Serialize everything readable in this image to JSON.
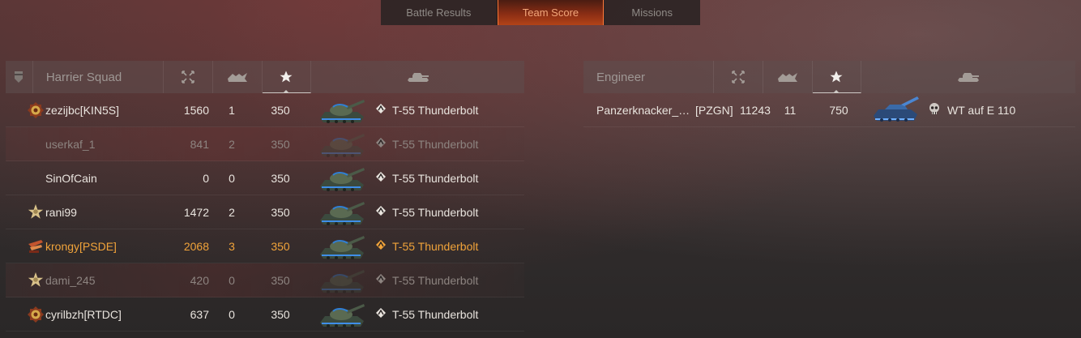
{
  "tabs": [
    "Battle Results",
    "Team Score",
    "Missions"
  ],
  "left": {
    "team_name": "Harrier Squad",
    "players": [
      {
        "name": "zezijbc[KIN5S]",
        "damage": "1560",
        "kills": "1",
        "xp": "350",
        "vehicle": "T-55 Thunderbolt",
        "badge": "medal-icon",
        "state": "normal"
      },
      {
        "name": "userkaf_1",
        "damage": "841",
        "kills": "2",
        "xp": "350",
        "vehicle": "T-55 Thunderbolt",
        "badge": "",
        "state": "dim"
      },
      {
        "name": "SinOfCain",
        "damage": "0",
        "kills": "0",
        "xp": "350",
        "vehicle": "T-55 Thunderbolt",
        "badge": "",
        "state": "normal"
      },
      {
        "name": "rani99",
        "damage": "1472",
        "kills": "2",
        "xp": "350",
        "vehicle": "T-55 Thunderbolt",
        "badge": "star-medal-icon",
        "state": "normal"
      },
      {
        "name": "krongy[PSDE]",
        "damage": "2068",
        "kills": "3",
        "xp": "350",
        "vehicle": "T-55 Thunderbolt",
        "badge": "clan-emblem-icon",
        "state": "me"
      },
      {
        "name": "dami_245",
        "damage": "420",
        "kills": "0",
        "xp": "350",
        "vehicle": "T-55 Thunderbolt",
        "badge": "star-medal-icon",
        "state": "dim"
      },
      {
        "name": "cyrilbzh[RTDC]",
        "damage": "637",
        "kills": "0",
        "xp": "350",
        "vehicle": "T-55 Thunderbolt",
        "badge": "medal-icon",
        "state": "normal"
      }
    ]
  },
  "right": {
    "team_name": "Engineer",
    "players": [
      {
        "name": "Panzerknacker_…",
        "clan": "[PZGN]",
        "damage": "11243",
        "kills": "11",
        "xp": "750",
        "vehicle": "WT auf E 110"
      }
    ]
  },
  "icons": {
    "header_score": "star-icon",
    "header_damage": "crosshair-icon",
    "header_kills": "destroyed-tank-icon",
    "header_vehicle": "tank-silhouette-icon",
    "vehicle_class": "medium-tank-class-icon",
    "boss_class": "skull-icon"
  },
  "colors": {
    "active_tab": "#b24318",
    "self_highlight": "#f1a33a"
  }
}
